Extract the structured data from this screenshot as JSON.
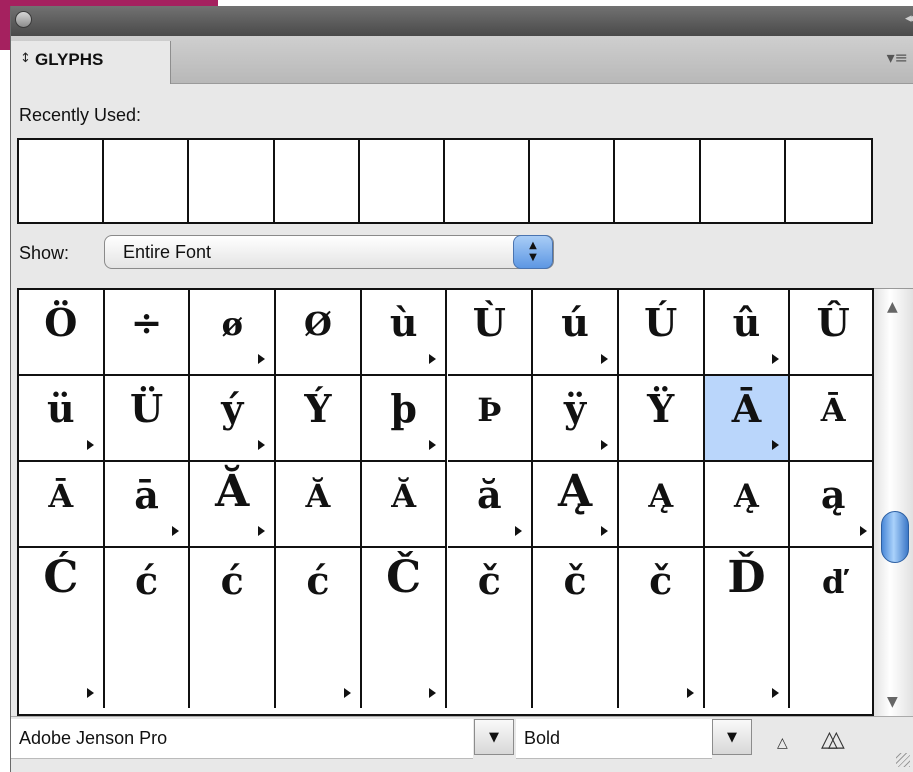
{
  "panel": {
    "tab_label": "GLYPHS",
    "tab_arrows": "↕",
    "collapse_glyph": "◂◂",
    "menu_glyph": "▾≡"
  },
  "recent": {
    "label": "Recently Used:",
    "cell_count": 10
  },
  "show": {
    "label": "Show:",
    "value": "Entire Font"
  },
  "glyphs": [
    [
      {
        "c": "Ö",
        "s": false,
        "sub": false
      },
      {
        "c": "÷",
        "s": false,
        "sub": false
      },
      {
        "c": "ø",
        "s": true,
        "sub": true
      },
      {
        "c": "Ø",
        "s": true,
        "sub": false
      },
      {
        "c": "ù",
        "s": false,
        "sub": true
      },
      {
        "c": "Ù",
        "s": false,
        "sub": false
      },
      {
        "c": "ú",
        "s": false,
        "sub": true
      },
      {
        "c": "Ú",
        "s": false,
        "sub": false
      },
      {
        "c": "û",
        "s": false,
        "sub": true
      },
      {
        "c": "Û",
        "s": false,
        "sub": false
      }
    ],
    [
      {
        "c": "ü",
        "s": false,
        "sub": true
      },
      {
        "c": "Ü",
        "s": false,
        "sub": false
      },
      {
        "c": "ý",
        "s": false,
        "sub": true
      },
      {
        "c": "Ý",
        "s": false,
        "sub": false
      },
      {
        "c": "þ",
        "s": false,
        "sub": true
      },
      {
        "c": "Þ",
        "s": true,
        "sub": false
      },
      {
        "c": "ÿ",
        "s": false,
        "sub": true
      },
      {
        "c": "Ÿ",
        "s": false,
        "sub": false
      },
      {
        "c": "Ā",
        "s": false,
        "sub": true,
        "selected": true
      },
      {
        "c": "Ā",
        "s": true,
        "sub": false
      }
    ],
    [
      {
        "c": "Ā",
        "s": true,
        "sub": false
      },
      {
        "c": "ā",
        "s": false,
        "sub": true
      },
      {
        "c": "Ă",
        "s": false,
        "sub": true,
        "l": true
      },
      {
        "c": "Ă",
        "s": true,
        "sub": false
      },
      {
        "c": "Ă",
        "s": true,
        "sub": false
      },
      {
        "c": "ă",
        "s": false,
        "sub": true
      },
      {
        "c": "Ą",
        "s": false,
        "sub": true,
        "l": true
      },
      {
        "c": "Ą",
        "s": true,
        "sub": false
      },
      {
        "c": "Ą",
        "s": true,
        "sub": false
      },
      {
        "c": "ą",
        "s": false,
        "sub": true
      }
    ],
    [
      {
        "c": "Ć",
        "s": false,
        "sub": true,
        "l": true
      },
      {
        "c": "ć",
        "s": false,
        "sub": false
      },
      {
        "c": "ć",
        "s": false,
        "sub": false
      },
      {
        "c": "ć",
        "s": false,
        "sub": true
      },
      {
        "c": "Č",
        "s": false,
        "sub": true,
        "l": true
      },
      {
        "c": "č",
        "s": false,
        "sub": false
      },
      {
        "c": "č",
        "s": false,
        "sub": false
      },
      {
        "c": "č",
        "s": false,
        "sub": true
      },
      {
        "c": "Ď",
        "s": false,
        "sub": true,
        "l": true
      },
      {
        "c": "ď",
        "s": true,
        "sub": false
      }
    ]
  ],
  "bottom": {
    "font_name": "Adobe Jenson Pro",
    "style_name": "Bold",
    "dropdown_glyph": "▼",
    "zoom_out_glyph": "△",
    "zoom_in_glyph": "△△"
  },
  "scroll": {
    "up_glyph": "▲",
    "down_glyph": "▼"
  }
}
